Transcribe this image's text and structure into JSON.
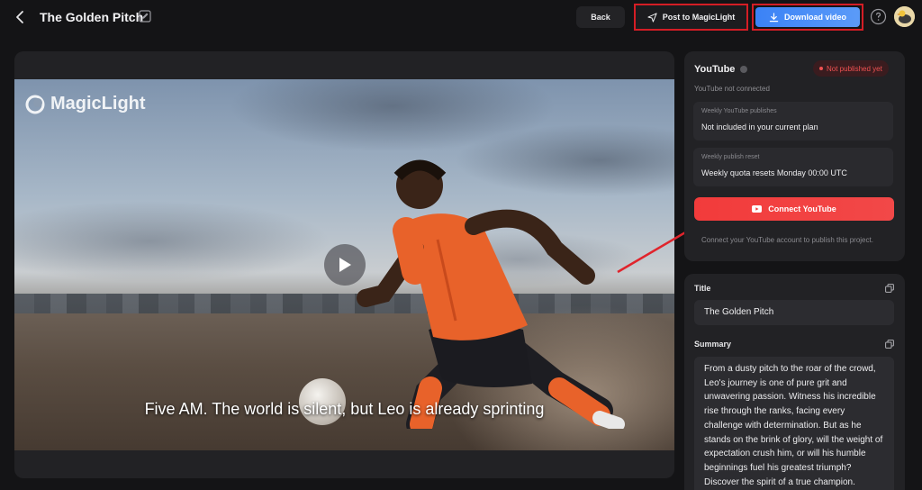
{
  "header": {
    "project_title": "The Golden Pitch",
    "back_label": "Back",
    "post_label": "Post to MagicLight",
    "download_label": "Download video"
  },
  "video": {
    "watermark": "MagicLight",
    "subtitle": "Five AM. The world is silent, but Leo is already sprinting"
  },
  "youtube": {
    "title": "YouTube",
    "status": "Not published yet",
    "connection_status": "YouTube not connected",
    "weekly_publishes_label": "Weekly YouTube publishes",
    "weekly_publishes_value": "Not included in your current plan",
    "weekly_reset_label": "Weekly publish reset",
    "weekly_reset_value": "Weekly quota resets Monday 00:00 UTC",
    "connect_label": "Connect YouTube",
    "connect_hint": "Connect your YouTube account to publish this project."
  },
  "metadata": {
    "title_label": "Title",
    "title_value": "The Golden Pitch",
    "summary_label": "Summary",
    "summary_value": "From a dusty pitch to the roar of the crowd, Leo's journey is one of pure grit and unwavering passion. Witness his incredible rise through the ranks, facing every challenge with determination. But as he stands on the brink of glory, will the weight of expectation crush him, or will his humble beginnings fuel his greatest triumph? Discover the spirit of a true champion."
  },
  "colors": {
    "accent_blue": "#3b82f6",
    "youtube_red": "#f23b3b",
    "highlight_red": "#d41d25",
    "jersey_orange": "#e8622a"
  },
  "icons": [
    "chevron-left-icon",
    "edit-icon",
    "send-icon",
    "download-icon",
    "help-icon",
    "play-icon",
    "info-icon",
    "youtube-icon",
    "copy-icon"
  ]
}
